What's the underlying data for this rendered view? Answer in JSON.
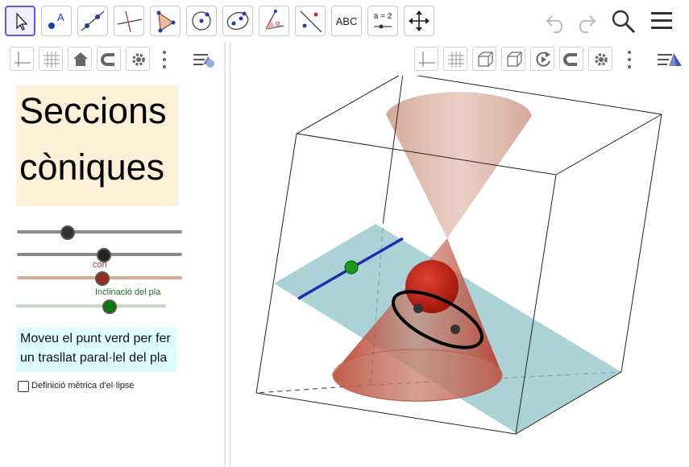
{
  "toolbar": {
    "tools": [
      {
        "name": "move-tool",
        "label": ""
      },
      {
        "name": "point-tool",
        "label": "A"
      },
      {
        "name": "line-tool",
        "label": ""
      },
      {
        "name": "perpendicular-line-tool",
        "label": ""
      },
      {
        "name": "polygon-tool",
        "label": ""
      },
      {
        "name": "circle-tool",
        "label": ""
      },
      {
        "name": "ellipse-tool",
        "label": ""
      },
      {
        "name": "angle-tool",
        "label": "α"
      },
      {
        "name": "reflect-tool",
        "label": ""
      },
      {
        "name": "text-tool",
        "label": "ABC"
      },
      {
        "name": "slider-tool",
        "label": "a = 2"
      },
      {
        "name": "move-graphics-view-tool",
        "label": ""
      }
    ]
  },
  "left_panel": {
    "title_line1": "Seccions",
    "title_line2": "còniques",
    "sliders": [
      {
        "name": "slider-1",
        "label": "",
        "value": 0.3,
        "color": "#777777",
        "knob": "#333333"
      },
      {
        "name": "slider-2",
        "label": "",
        "value": 0.5,
        "color": "#777777",
        "knob": "#222222"
      },
      {
        "name": "slider-con",
        "label": "con",
        "value": 0.5,
        "color": "#d9a995",
        "knob": "#9b2b1e"
      },
      {
        "name": "slider-inclinacio",
        "label": "Inclinació del pla",
        "value": 0.62,
        "color": "#c8d6c8",
        "knob": "#0a7a0a"
      }
    ],
    "info_line1": "Moveu el punt verd per fer",
    "info_line2": "un trasllat paral·lel del pla",
    "checkbox_label": "Definició mètrica d'el·lipse",
    "checkbox_checked": false
  },
  "colors": {
    "accent": "#6557d2",
    "cone": "#c98a78",
    "plane": "#8fc3c9",
    "sphere": "#b51a10",
    "line": "#1a2fb0",
    "green_point": "#1a9a1a"
  }
}
